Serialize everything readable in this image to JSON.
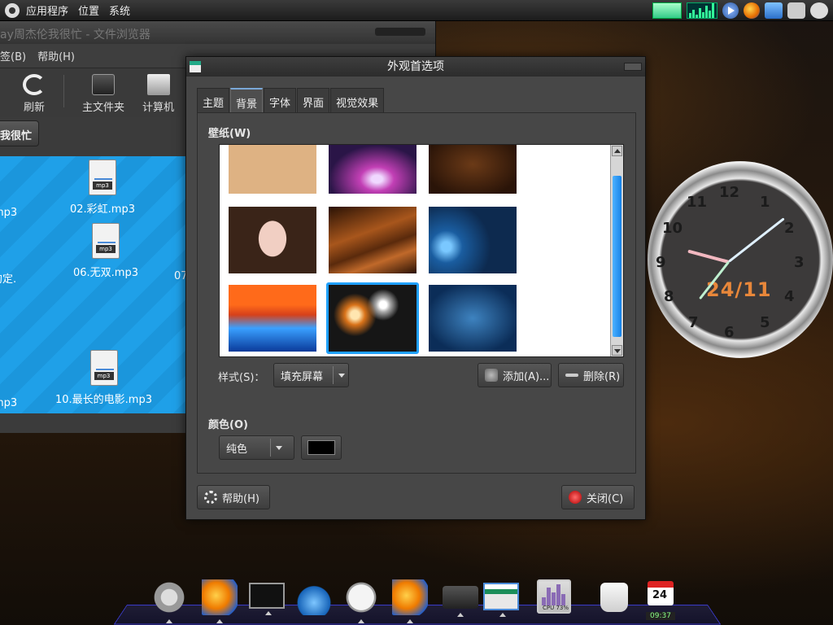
{
  "top_panel": {
    "menus": [
      "应用程序",
      "位置",
      "系统"
    ]
  },
  "file_manager": {
    "title": "ay周杰伦我很忙 - 文件浏览器",
    "menus": [
      "签(B)",
      "帮助(H)"
    ],
    "toolbar": {
      "refresh": "刷新",
      "home": "主文件夹",
      "computer": "计算机"
    },
    "location": "我很忙",
    "files": [
      "mp3",
      "02.彩虹.mp3",
      "约定.",
      "06.无双.mp3",
      "07",
      "mp3",
      "10.最长的电影.mp3"
    ]
  },
  "dialog": {
    "title": "外观首选项",
    "tabs": [
      "主题",
      "背景",
      "字体",
      "界面",
      "视觉效果"
    ],
    "active_tab": 1,
    "wallpaper_label": "壁纸(W)",
    "style_label": "样式(S)：",
    "style_value": "填充屏幕",
    "add_label": "添加(A)...",
    "remove_label": "删除(R)",
    "color_label": "颜色(O)",
    "color_mode": "纯色",
    "color_value": "#000000",
    "help_label": "帮助(H)",
    "close_label": "关闭(C)"
  },
  "clock_widget": {
    "date": "24/11",
    "numbers": [
      "12",
      "1",
      "2",
      "3",
      "4",
      "5",
      "6",
      "7",
      "8",
      "9",
      "10",
      "11"
    ]
  },
  "dock": {
    "cpu_label": "CPU 73%",
    "calendar_day": "24",
    "calendar_time": "09:37"
  }
}
